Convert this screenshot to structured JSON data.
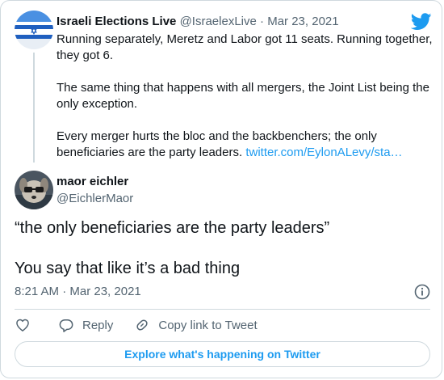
{
  "parent_tweet": {
    "display_name": "Israeli Elections Live",
    "handle": "@IsraelexLive",
    "separator": "·",
    "date": "Mar 23, 2021",
    "paragraph_1": "Running separately, Meretz and Labor got 11 seats. Running together, they got 6.",
    "paragraph_2": "The same thing that happens with all mergers, the Joint List being the only exception.",
    "paragraph_3": "Every merger hurts the bloc and the backbenchers; the only beneficiaries are the party leaders.",
    "link": "twitter.com/EylonALevy/sta…",
    "avatar_icon": "israel-flag-avatar"
  },
  "tweet": {
    "display_name": "maor eichler",
    "handle": "@EichlerMaor",
    "text_line_1": "“the only beneficiaries are the party leaders”",
    "text_line_2": "You say that like it’s a bad thing",
    "timestamp": "8:21 AM · Mar 23, 2021",
    "avatar_icon": "dog-avatar"
  },
  "actions": {
    "like_icon": "heart-icon",
    "reply_label": "Reply",
    "copy_label": "Copy link to Tweet"
  },
  "explore_button": "Explore what's happening on Twitter",
  "colors": {
    "accent": "#1d9bf0",
    "text": "#0f1419",
    "muted": "#536471",
    "border": "#cfd9de"
  }
}
